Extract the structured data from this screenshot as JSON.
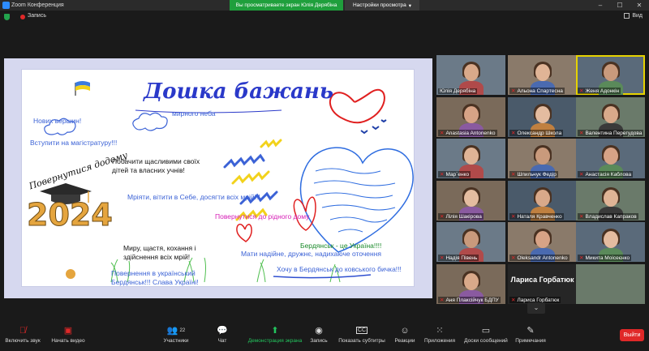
{
  "titlebar": {
    "app_title": "Zoom Конференция",
    "share_banner": "Вы просматриваете экран Юлія Дерябіна",
    "view_settings": "Настройки просмотра"
  },
  "recbar": {
    "record_label": "Запись",
    "view_label": "Вид"
  },
  "board": {
    "title": "Дошка бажань",
    "wishes": [
      {
        "text": "Нових вершин!",
        "color": "#3b62d6"
      },
      {
        "text": "Вступити на магістратуру!!!",
        "color": "#3b62d6"
      },
      {
        "text": "мирного неба",
        "color": "#3b62d6"
      },
      {
        "text": "Побачити щасливими своїх",
        "color": "#111111"
      },
      {
        "text": "дітей та власних учнів!",
        "color": "#111111"
      },
      {
        "text": "Мріяти, вітити в Себе, досягти всіх мрій!!!",
        "color": "#3b62d6"
      },
      {
        "text": "Повернутися до рідного дому",
        "color": "#d61eb6"
      },
      {
        "text": "Миру, щастя, кохання і",
        "color": "#111111"
      },
      {
        "text": "здійснення всіх мрій!",
        "color": "#111111"
      },
      {
        "text": "Повернення в український",
        "color": "#3b62d6"
      },
      {
        "text": "Бердянськ!!! Слава Україні!",
        "color": "#3b62d6"
      },
      {
        "text": "Бердянськ - це Україна!!!!",
        "color": "#1a8a2a"
      },
      {
        "text": "Мати надійне, дружнє, надихаюче оточення",
        "color": "#3b62d6"
      },
      {
        "text": "Хочу в Бердянськ до ковського бичка!!!",
        "color": "#3b62d6"
      }
    ],
    "handwriting": "Повернутися додому",
    "year": "2024"
  },
  "gallery": [
    {
      "name": "Юлія Дерябіна",
      "muted": false
    },
    {
      "name": "Альона Спартесна",
      "muted": true
    },
    {
      "name": "Женя Адонкін",
      "muted": true
    },
    {
      "name": "Anastasia Antonenko",
      "muted": true
    },
    {
      "name": "Олександр Школа",
      "muted": true
    },
    {
      "name": "Валентина Перегудова",
      "muted": true
    },
    {
      "name": "Мар`енко",
      "muted": true
    },
    {
      "name": "Шпильчук Федір",
      "muted": true
    },
    {
      "name": "Анастасія Каблова",
      "muted": true
    },
    {
      "name": "Лілія Шакірова",
      "muted": true
    },
    {
      "name": "Наталя Кравченко",
      "muted": true
    },
    {
      "name": "Владислав Капраков",
      "muted": true
    },
    {
      "name": "Надія Півень",
      "muted": true
    },
    {
      "name": "Oleksandr Antonenko",
      "muted": true
    },
    {
      "name": "Микита Моісеєнко",
      "muted": true
    },
    {
      "name": "Аня Плаксійчук БДПУ",
      "muted": true
    },
    {
      "name": "Лариса Горбатюк",
      "muted": true
    },
    {
      "name": "",
      "muted": true
    }
  ],
  "tile_big_text": "Лариса Горбатюк",
  "toolbar": {
    "mic": "Включить звук",
    "video": "Начать видео",
    "participants": "Участники",
    "participants_count": "22",
    "chat": "Чат",
    "share": "Демонстрация экрана",
    "record": "Запись",
    "captions": "Показать субтитры",
    "reactions": "Реакции",
    "apps": "Приложения",
    "whiteboards": "Доски сообщений",
    "notes": "Примечания",
    "exit": "Выйти"
  }
}
